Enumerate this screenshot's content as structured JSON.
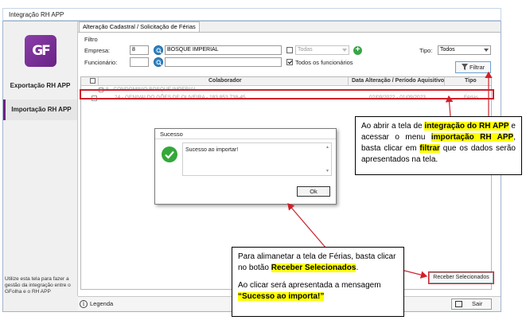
{
  "window": {
    "title": "Integração RH APP"
  },
  "sidebar": {
    "logo_text": "GF",
    "items": [
      {
        "label": "Exportação RH APP"
      },
      {
        "label": "Importação RH APP"
      }
    ],
    "help_text": "Utilize esta tela para fazer a gestão da integração entre o GFolha e o RH APP"
  },
  "tab": {
    "label": "Alteração Cadastral / Solicitação de Férias"
  },
  "filter": {
    "group_label": "Filtro",
    "empresa_label": "Empresa:",
    "empresa_code": "8",
    "empresa_name": "BOSQUE IMPERIAL",
    "todas_label": "Todas",
    "funcionario_label": "Funcionário:",
    "funcionario_code": "",
    "funcionario_name": "",
    "todos_funcionarios_label": "Todos os funcionários",
    "tipo_label": "Tipo:",
    "tipo_value": "Todos",
    "filtrar_label": "Filtrar"
  },
  "grid": {
    "columns": [
      "Colaborador",
      "Data Alteração / Período Aquisitivo",
      "Tipo"
    ],
    "group_row": "8 - CONDOMINIO BOSQUE IMPERIAL",
    "rows": [
      {
        "colaborador": "24 - GENIVALDO GÕES DE OLIVEIRA - 183.853.738-45",
        "periodo": "02/09/2022 - 01/09/2023",
        "tipo": "Férias"
      }
    ]
  },
  "buttons": {
    "receber": "Receber Selecionados",
    "sair": "Sair"
  },
  "statusbar": {
    "legenda": "Legenda"
  },
  "dialog": {
    "title": "Sucesso",
    "message": "Sucesso ao importar!",
    "ok": "Ok"
  },
  "callouts": {
    "c1": {
      "t1": "Ao abrir a tela de ",
      "h1": "integração do RH APP",
      "t2": " e acessar o menu ",
      "h2": "importação RH APP",
      "t3": ", basta clicar em ",
      "h3": "filtrar",
      "t4": " que os dados serão apresentados na tela."
    },
    "c2": {
      "t1": "Para alimanetar a tela de Férias, basta clicar no botão ",
      "h1": "Receber Selecionados",
      "t2": ".",
      "t3": "Ao clicar será apresentada a mensagem ",
      "h2": "“Sucesso ao importa!”"
    }
  },
  "colors": {
    "accent": "#6a2286",
    "annotation_red": "#d0202a",
    "highlight": "#ffff00",
    "success": "#34a83a"
  }
}
